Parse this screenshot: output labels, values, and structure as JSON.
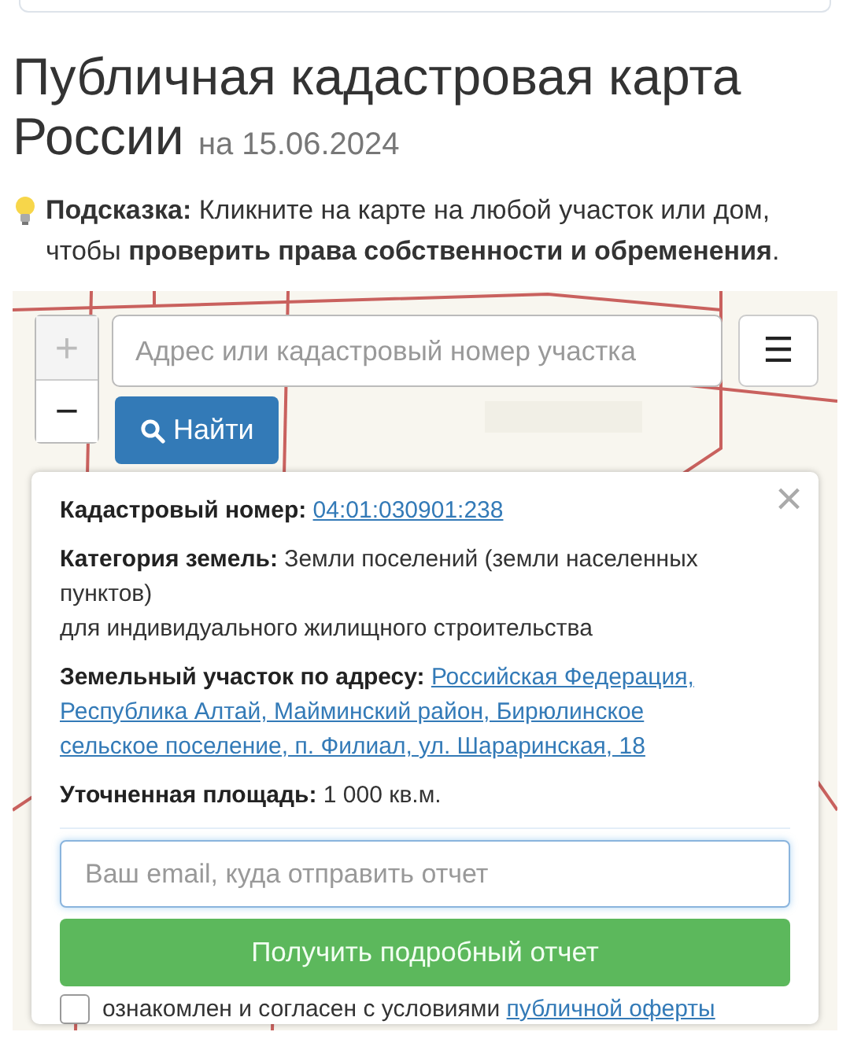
{
  "heading": {
    "title": "Публичная кадастровая карта России",
    "date": "на 15.06.2024"
  },
  "hint": "**Подсказка:** Кликните на карте на любой участок или дом, чтобы **проверить права собственности и обременения**.",
  "map": {
    "zoom_in": {
      "label": "+",
      "disabled": true
    },
    "zoom_out": {
      "label": "−",
      "disabled": false
    },
    "search": {
      "placeholder": "Адрес или кадастровый номер участка"
    },
    "menu": "☰",
    "find_button": "Найти"
  },
  "popup": {
    "close": "×",
    "fields": [
      {
        "kind": "link",
        "label": "Кадастровый номер:",
        "lines": [
          "04:01:030901:238"
        ]
      },
      {
        "kind": "text",
        "label": "Категория земель:",
        "lines": [
          "Земли поселений (земли населенных пунктов)",
          "для индивидуального жилищного строительства"
        ]
      },
      {
        "kind": "link",
        "label": "Земельный участок по адресу:",
        "lines": [
          "Российская Федерация,",
          "Республика Алтай, Майминский район, Бирюлинское",
          "сельское поселение, п. Филиал, ул. Шараринская, 18"
        ]
      },
      {
        "kind": "text",
        "label": "Уточненная площадь:",
        "lines": [
          "1 000 кв.м."
        ]
      }
    ],
    "email": {
      "placeholder": "Ваш email, куда отправить отчет"
    },
    "report_button": "Получить подробный отчет",
    "consent": {
      "checked": false,
      "text": "ознакомлен и согласен с условиями",
      "link": "публичной оферты"
    }
  }
}
